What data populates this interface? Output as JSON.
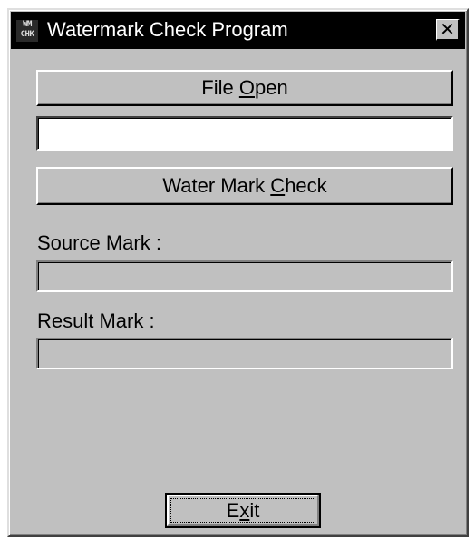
{
  "window": {
    "title": "Watermark Check Program",
    "icon_text_top": "WM",
    "icon_text_bottom": "CHK",
    "close_glyph": "✕"
  },
  "buttons": {
    "file_open": {
      "before": "File ",
      "mnemonic": "O",
      "after": "pen"
    },
    "water_mark_check": {
      "before": "Water Mark ",
      "mnemonic": "C",
      "after": "heck"
    },
    "exit": {
      "before": "E",
      "mnemonic": "x",
      "after": "it"
    }
  },
  "file_path": {
    "value": "",
    "placeholder": ""
  },
  "source_mark": {
    "label": "Source Mark :",
    "value": ""
  },
  "result_mark": {
    "label": "Result Mark  :",
    "value": ""
  },
  "colors": {
    "window_bg": "#c0c0c0",
    "titlebar_bg": "#000000",
    "titlebar_text": "#ffffff"
  },
  "icons": {
    "app": "app-icon",
    "close": "close-icon"
  }
}
